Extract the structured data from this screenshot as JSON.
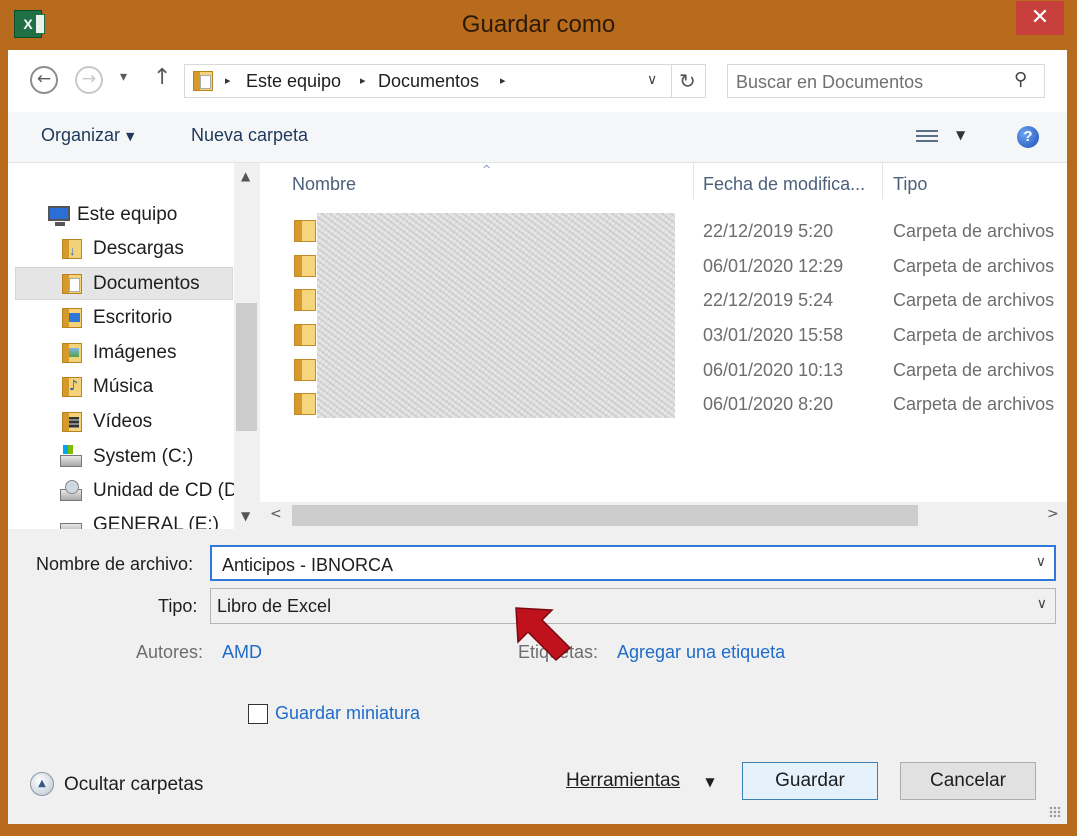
{
  "window": {
    "title": "Guardar como",
    "app_icon_letter": "X",
    "close_symbol": "✕"
  },
  "nav": {
    "back_symbol": "←",
    "forward_symbol": "→",
    "recent_symbol": "▾",
    "up_symbol": "↑",
    "breadcrumbs": [
      "Este equipo",
      "Documentos"
    ],
    "breadcrumb_sep": "▸",
    "dropdown_symbol": "∨",
    "refresh_symbol": "↻",
    "search_placeholder": "Buscar en Documentos",
    "search_symbol": "⚲"
  },
  "toolbar": {
    "organize": "Organizar",
    "new_folder": "Nueva carpeta",
    "caret": "▼",
    "help": "?"
  },
  "sidebar": {
    "items": [
      {
        "label": "Este equipo",
        "icon": "computer-icon"
      },
      {
        "label": "Descargas",
        "icon": "downloads-folder-icon"
      },
      {
        "label": "Documentos",
        "icon": "documents-folder-icon",
        "selected": true
      },
      {
        "label": "Escritorio",
        "icon": "desktop-folder-icon"
      },
      {
        "label": "Imágenes",
        "icon": "pictures-folder-icon"
      },
      {
        "label": "Música",
        "icon": "music-folder-icon"
      },
      {
        "label": "Vídeos",
        "icon": "videos-folder-icon"
      },
      {
        "label": "System (C:)",
        "icon": "system-drive-icon"
      },
      {
        "label": "Unidad de CD (D:",
        "icon": "cd-drive-icon"
      },
      {
        "label": "GENERAL (E:)",
        "icon": "drive-icon"
      }
    ],
    "scroll_up": "▲",
    "scroll_down": "▼"
  },
  "filelist": {
    "sort_caret": "^",
    "columns": [
      "Nombre",
      "Fecha de modifica...",
      "Tipo"
    ],
    "rows": [
      {
        "date": "22/12/2019 5:20",
        "type": "Carpeta de archivos"
      },
      {
        "date": "06/01/2020 12:29",
        "type": "Carpeta de archivos"
      },
      {
        "date": "22/12/2019 5:24",
        "type": "Carpeta de archivos"
      },
      {
        "date": "03/01/2020 15:58",
        "type": "Carpeta de archivos"
      },
      {
        "date": "06/01/2020 10:13",
        "type": "Carpeta de archivos"
      },
      {
        "date": "06/01/2020 8:20",
        "type": "Carpeta de archivos"
      }
    ],
    "scroll_left": "<",
    "scroll_right": ">"
  },
  "form": {
    "filename_label": "Nombre de archivo:",
    "filename_value": "Anticipos - IBNORCA",
    "type_label": "Tipo:",
    "type_value": "Libro de Excel",
    "authors_label": "Autores:",
    "authors_value": "AMD",
    "tags_label": "Etiquetas:",
    "tags_value": "Agregar una etiqueta",
    "thumbnail_label": "Guardar miniatura",
    "dd_symbol": "∨"
  },
  "footer": {
    "hide_folders": "Ocultar carpetas",
    "hide_symbol": "▲",
    "tools": "Herramientas",
    "tools_caret": "▼",
    "save": "Guardar",
    "cancel": "Cancelar"
  },
  "colors": {
    "frame": "#b86a1d",
    "close": "#c7403b",
    "link": "#1f6bc9",
    "annotation_arrow": "#c0121c"
  }
}
